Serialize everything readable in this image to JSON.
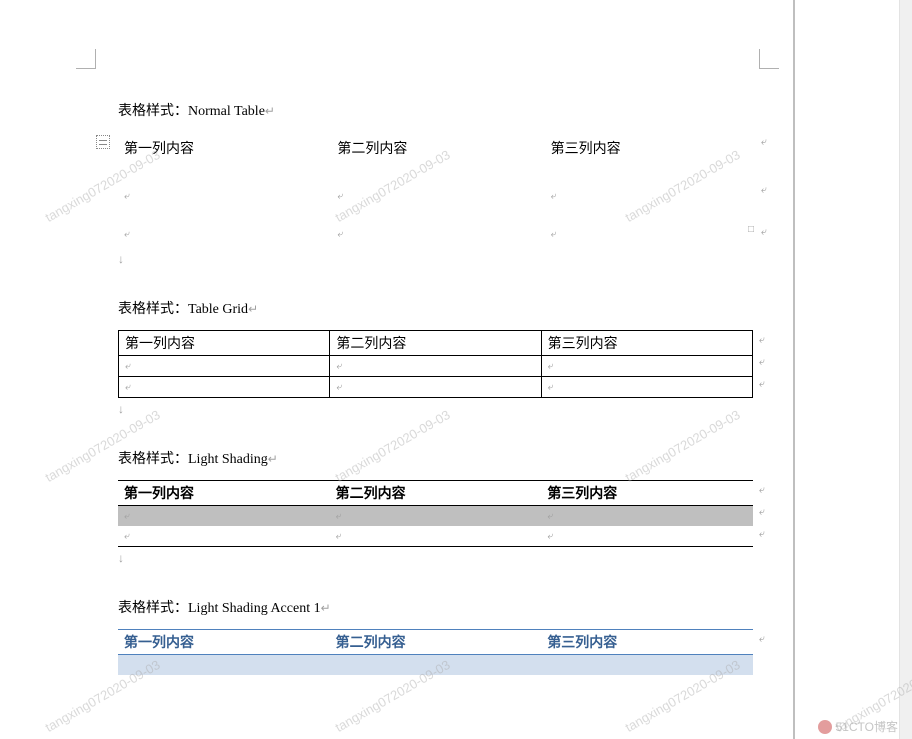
{
  "labels": {
    "prefix": "表格样式：",
    "styles": {
      "normal": "Normal Table",
      "grid": "Table Grid",
      "light_shading": "Light Shading",
      "accent1": "Light Shading Accent 1"
    }
  },
  "columns": {
    "col1": "第一列内容",
    "col2": "第二列内容",
    "col3": "第三列内容"
  },
  "watermark_text": "tangxing072020-09-03",
  "site_watermark": "51CTO博客",
  "colors": {
    "accent1_text": "#365f91",
    "accent1_border": "#4f81bd",
    "accent1_band": "#d3dfee",
    "lightshade_band": "#bfbfbf"
  }
}
